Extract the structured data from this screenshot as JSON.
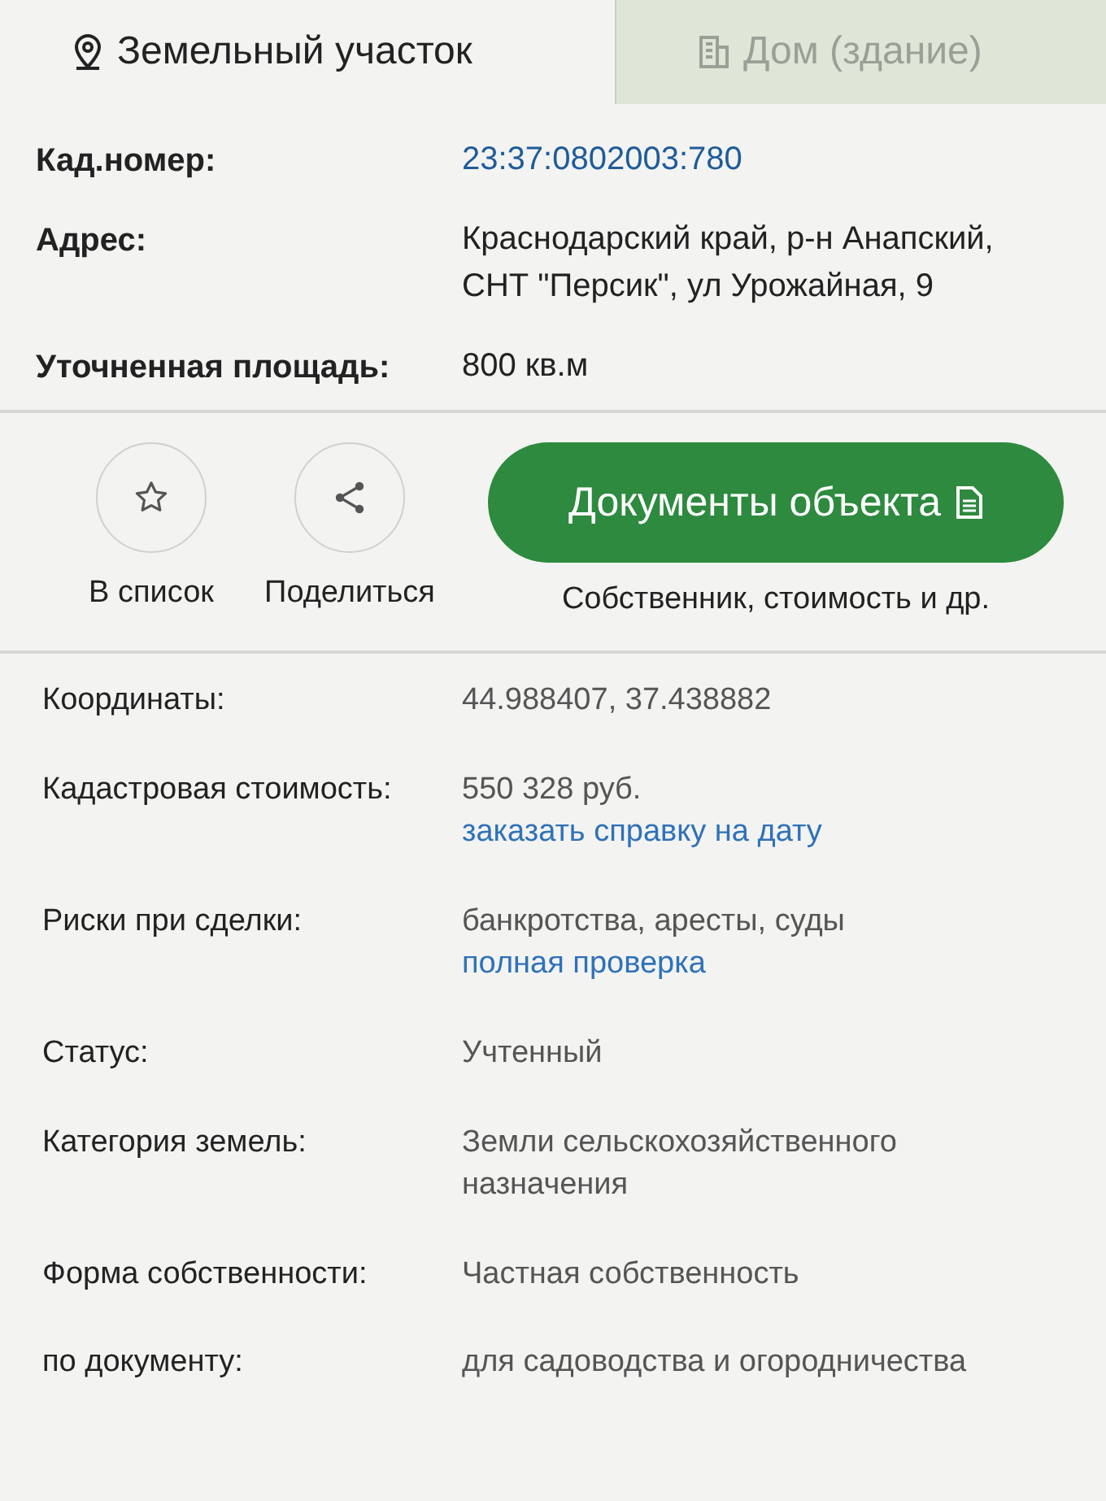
{
  "tabs": [
    {
      "label": "Земельный участок",
      "selected": true,
      "kind": "pin"
    },
    {
      "label": "Дом (здание)",
      "selected": false,
      "kind": "building"
    }
  ],
  "summary": [
    {
      "label": "Кад.номер:",
      "value": "23:37:0802003:780",
      "kind": "link"
    },
    {
      "label": "Адрес:",
      "value": "Краснодарский край, р-н Анапский, СНТ \"Персик\", ул Урожайная, 9",
      "kind": "text"
    },
    {
      "label": "Уточненная площадь:",
      "value": "800 кв.м",
      "kind": "text"
    }
  ],
  "actions": [
    {
      "label": "В список",
      "kind": "star"
    },
    {
      "label": "Поделиться",
      "kind": "share"
    }
  ],
  "documents": {
    "label": "Документы объекта",
    "caption": "Собственник, стоимость и др."
  },
  "details": [
    {
      "label": "Координаты:",
      "lines": [
        {
          "text": "44.988407, 37.438882",
          "link": false
        }
      ]
    },
    {
      "label": "Кадастровая стоимость:",
      "lines": [
        {
          "text": "550 328 руб.",
          "link": false
        },
        {
          "text": "заказать справку на дату",
          "link": true
        }
      ]
    },
    {
      "label": "Риски при сделки:",
      "lines": [
        {
          "text": "банкротства, аресты, суды",
          "link": false
        },
        {
          "text": "полная проверка",
          "link": true
        }
      ]
    },
    {
      "label": "Статус:",
      "lines": [
        {
          "text": "Учтенный",
          "link": false
        }
      ]
    },
    {
      "label": "Категория земель:",
      "lines": [
        {
          "text": "Земли сельскохозяйственного назначения",
          "link": false
        }
      ]
    },
    {
      "label": "Форма собственности:",
      "lines": [
        {
          "text": "Частная собственность",
          "link": false
        }
      ]
    },
    {
      "label": "по документу:",
      "lines": [
        {
          "text": "для садоводства и огородничества",
          "link": false
        }
      ]
    }
  ]
}
